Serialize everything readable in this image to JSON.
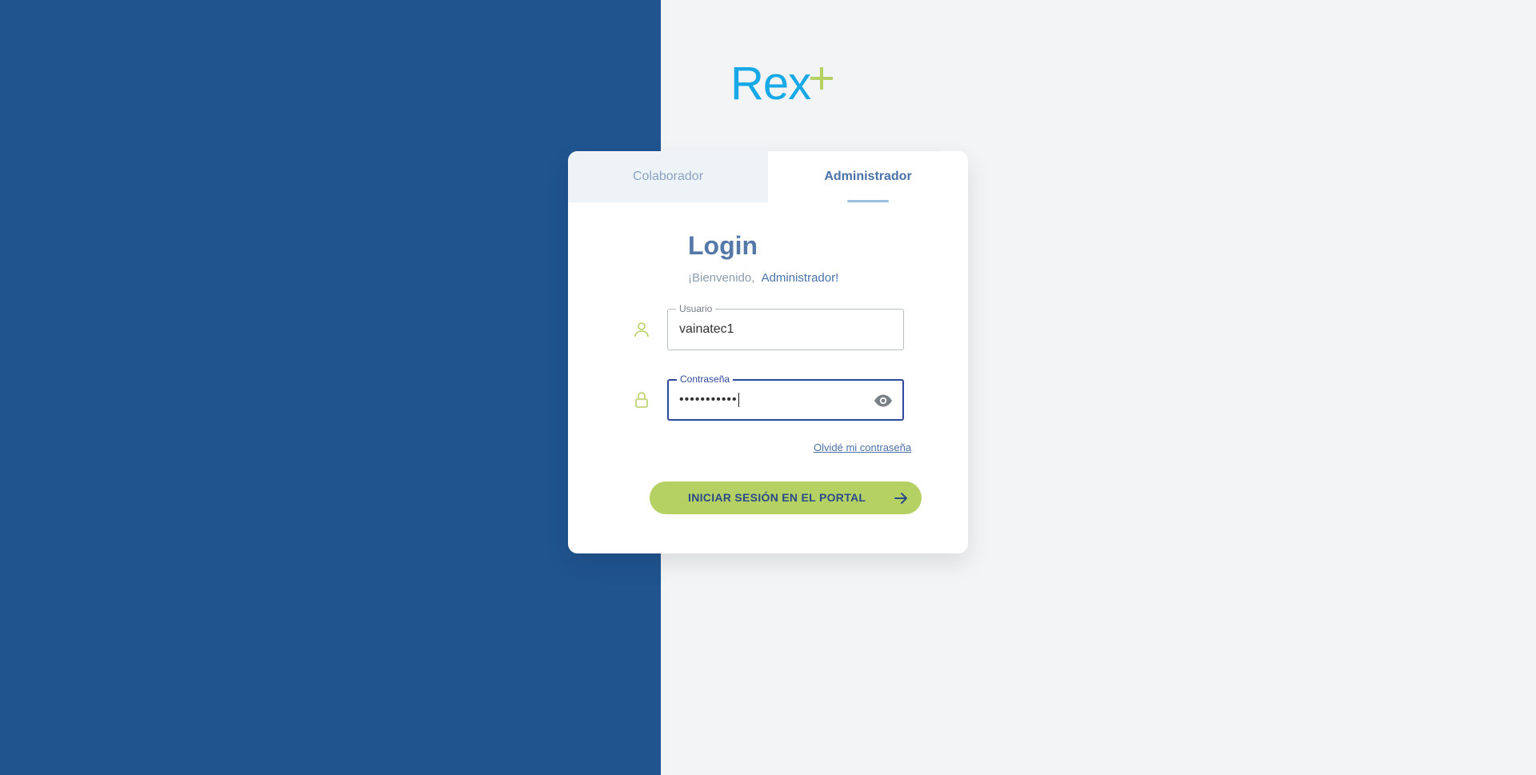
{
  "brand": {
    "logo_text": "Rex",
    "logo_plus": "+",
    "colors": {
      "primary_blue": "#20548f",
      "logo_blue": "#17a9e7",
      "accent_green": "#b6d163",
      "background": "#f3f4f6"
    }
  },
  "tabs": [
    {
      "label": "Colaborador",
      "active": false
    },
    {
      "label": "Administrador",
      "active": true
    }
  ],
  "login": {
    "title": "Login",
    "welcome_text": "¡Bienvenido,",
    "welcome_role": "Administrador!"
  },
  "fields": {
    "username": {
      "label": "Usuario",
      "value": "vainatec1",
      "icon": "user-icon"
    },
    "password": {
      "label": "Contraseña",
      "masked_value": "•••••••••••",
      "icon": "lock-icon",
      "toggle_icon": "eye-icon"
    }
  },
  "forgot_password_label": "Olvidé mi contraseña",
  "submit": {
    "label": "INICIAR SESIÓN EN EL PORTAL",
    "icon": "arrow-right-icon"
  }
}
